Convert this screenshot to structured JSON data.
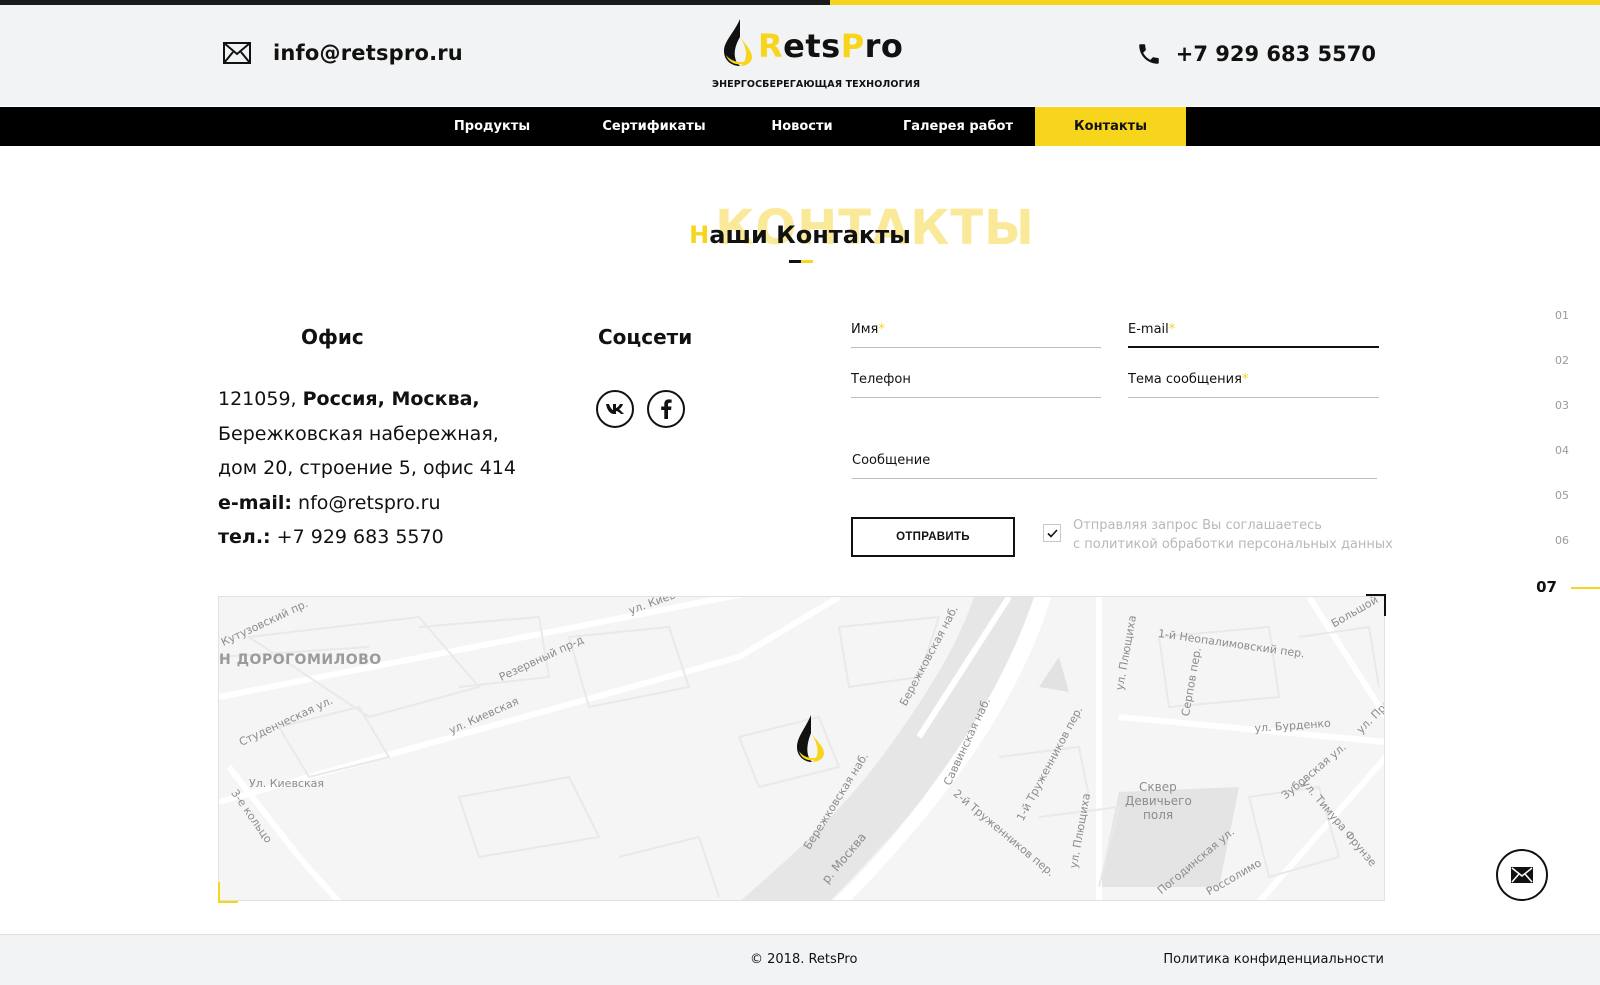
{
  "header": {
    "email": "info@retspro.ru",
    "phone": "+7 929 683 5570",
    "logo": {
      "brand_r": "R",
      "brand_ets": "ets",
      "brand_p": "P",
      "brand_ro": "ro",
      "tagline": "ЭНЕРГОСБЕРЕГАЮЩАЯ ТЕХНОЛОГИЯ"
    }
  },
  "nav": {
    "items": [
      {
        "label": "Продукты"
      },
      {
        "label": "Сертификаты"
      },
      {
        "label": "Новости"
      },
      {
        "label": "Галерея работ"
      },
      {
        "label": "Контакты"
      }
    ],
    "active_index": 4
  },
  "section": {
    "ghost_text": "КОНТАКТЫ",
    "title_first": "Н",
    "title_rest": "аши Контакты"
  },
  "office": {
    "heading": "Офис",
    "postcode": "121059, ",
    "city": "Россия, Москва,",
    "street": "Бережковская набережная,",
    "building": "дом 20, строение 5, офис 414",
    "email_label": "e-mail:",
    "email_value": " nfo@retspro.ru",
    "phone_label": "тел.:",
    "phone_value": " +7 929 683 5570"
  },
  "social": {
    "heading": "Соцсети",
    "icons": [
      "vk-icon",
      "facebook-icon"
    ]
  },
  "form": {
    "name_label": "Имя",
    "email_label": "E-mail",
    "phone_label": "Телефон",
    "subject_label": "Тема сообщения",
    "message_label": "Сообщение",
    "required_mark": "*",
    "submit_label": "ОТПРАВИТЬ",
    "agree_line1": "Отправляя запрос Вы соглашаетесь",
    "agree_line2": "с политикой обработки персональных данных",
    "agree_checked": true
  },
  "pager": {
    "items": [
      "01",
      "02",
      "03",
      "04",
      "05",
      "06",
      "07"
    ],
    "active": "07"
  },
  "map": {
    "labels": [
      "Кутузовский пр.",
      "Н ДОРОГОМИЛОВО",
      "Студенческая ул.",
      "ул. Киевская",
      "Ул. Киевская",
      "3-е кольцо",
      "Резервный пр-д",
      "ул. Киевская",
      "Бережковская наб.",
      "Бережковская наб.",
      "р. Москва",
      "Саввинская наб.",
      "ул. Плющиха",
      "1-й Неопалимовский пер.",
      "Серпов пер.",
      "ул. Бурденко",
      "1-й Труженников пер.",
      "2-й Труженников пер.",
      "ул. Плющиха",
      "Сквер",
      "Девичьего",
      "поля",
      "Зубовская ул.",
      "ул. Тимура Фрунзе",
      "Погодинская ул.",
      "Россолимо",
      "Большой",
      "ул. Пре"
    ]
  },
  "footer": {
    "copyright": "© 2018. RetsPro",
    "policy": "Политика конфиденциальности"
  },
  "colors": {
    "accent": "#f7d51d",
    "dark": "#111111",
    "header_bg": "#f2f3f4"
  }
}
